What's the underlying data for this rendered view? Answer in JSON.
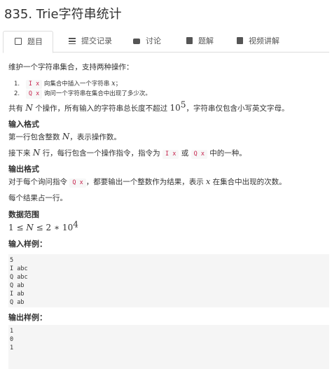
{
  "title": "835. Trie字符串统计",
  "tabs": [
    {
      "label": "题目",
      "icon": "book-icon"
    },
    {
      "label": "提交记录",
      "icon": "list-icon"
    },
    {
      "label": "讨论",
      "icon": "comment-icon"
    },
    {
      "label": "题解",
      "icon": "book-filled-icon"
    },
    {
      "label": "视频讲解",
      "icon": "video-icon"
    }
  ],
  "problem": {
    "intro": "维护一个字符串集合，支持两种操作：",
    "ops": [
      {
        "num": "1.",
        "code": "I x",
        "text_before": "向集合中插入一个字符串",
        "var": "x",
        "text_after": "；"
      },
      {
        "num": "2.",
        "code": "Q x",
        "text": "询问一个字符串在集合中出现了多少次。"
      }
    ],
    "constraint_a": "共有",
    "constraint_N": "N",
    "constraint_b": "个操作，所有输入的字符串总长度不超过",
    "constraint_pow_base": "10",
    "constraint_pow_exp": "5",
    "constraint_c": "，字符串仅包含小写英文字母。",
    "input_heading": "输入格式",
    "input_line1_a": "第一行包含整数",
    "input_line1_N": "N",
    "input_line1_b": "，表示操作数。",
    "input_line2_a": "接下来",
    "input_line2_N": "N",
    "input_line2_b": "行，每行包含一个操作指令，指令为",
    "input_line2_code1": "I x",
    "input_line2_or": "或",
    "input_line2_code2": "Q x",
    "input_line2_c": "中的一种。",
    "output_heading": "输出格式",
    "output_line1_a": "对于每个询问指令",
    "output_line1_code": "Q x",
    "output_line1_b": "，都要输出一个整数作为结果，表示",
    "output_line1_x": "x",
    "output_line1_c": "在集合中出现的次数。",
    "output_line2": "每个结果占一行。",
    "range_heading": "数据范围",
    "range_math_a": "1 ≤ ",
    "range_math_N": "N",
    "range_math_b": " ≤ 2 ∗ 10",
    "range_math_exp": "4",
    "sample_in_heading": "输入样例：",
    "sample_in": [
      "5",
      "I abc",
      "Q abc",
      "Q ab",
      "I ab",
      "Q ab"
    ],
    "sample_out_heading": "输出样例：",
    "sample_out": [
      "1",
      "0",
      "1"
    ]
  }
}
